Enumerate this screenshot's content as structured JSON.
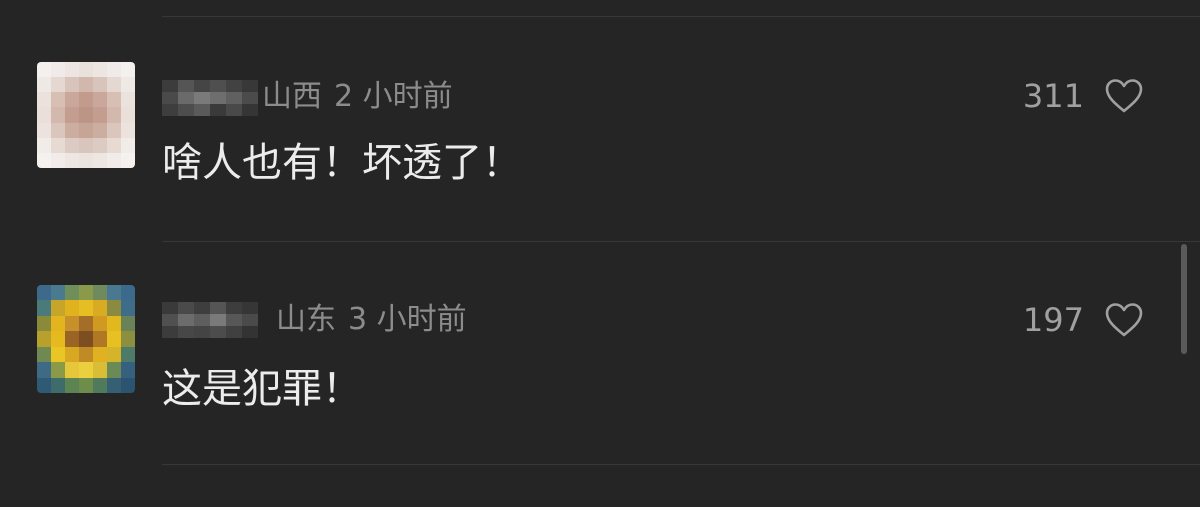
{
  "comments": [
    {
      "region": "山西",
      "time": "2 小时前",
      "text": "啥人也有！坏透了！",
      "likes": "311",
      "avatar_icon": "blurred-avatar-photo"
    },
    {
      "region": "山东",
      "time": "3 小时前",
      "text": "这是犯罪！",
      "likes": "197",
      "avatar_icon": "blurred-avatar-sunflower"
    }
  ],
  "icons": {
    "like": "heart-outline-icon"
  },
  "colors": {
    "background": "#252525",
    "text": "#ececec",
    "meta": "#8c8c8c",
    "like_count": "#a0a0a0",
    "divider": "#383838"
  }
}
